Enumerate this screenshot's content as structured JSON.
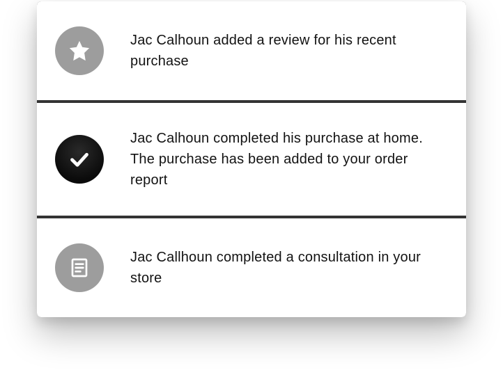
{
  "notifications": [
    {
      "icon": "star",
      "text": "Jac Calhoun added a review for his recent purchase"
    },
    {
      "icon": "check",
      "text": "Jac Calhoun completed his purchase at home. The purchase has been added to your order report"
    },
    {
      "icon": "document",
      "text": "Jac Callhoun completed a consultation in your store"
    }
  ]
}
